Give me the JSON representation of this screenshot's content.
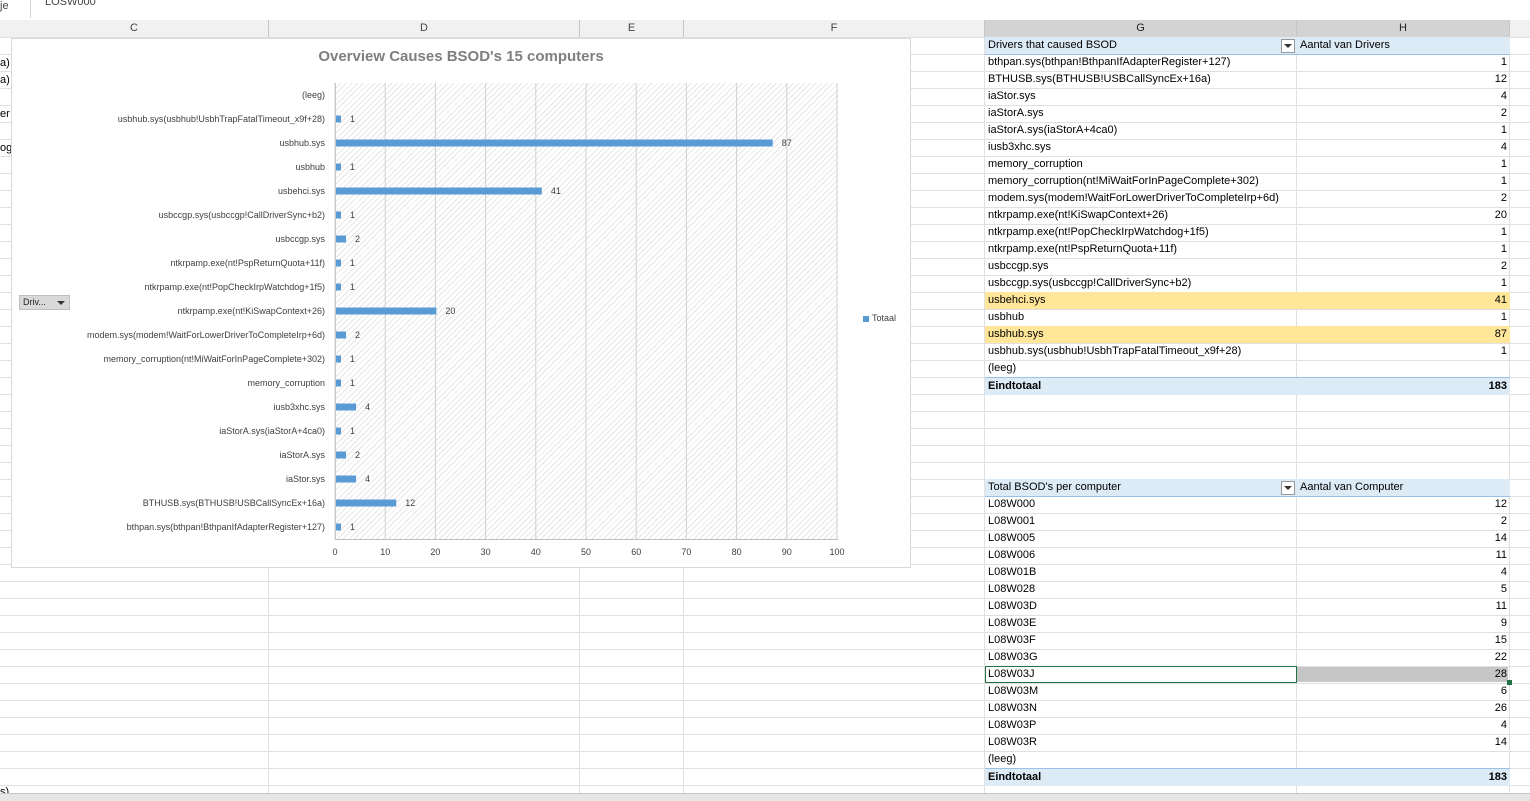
{
  "formula_bar": {
    "value": "LOSW000"
  },
  "columns": [
    "C",
    "D",
    "E",
    "F",
    "G",
    "H"
  ],
  "left_fragments": [
    "a)",
    "a)",
    "er",
    "og",
    "s)"
  ],
  "chart": {
    "title": "Overview Causes BSOD's 15 computers",
    "field_button": "Driv...",
    "legend": "Totaal"
  },
  "chart_data": {
    "type": "bar",
    "orientation": "horizontal",
    "title": "Overview Causes BSOD's 15 computers",
    "categories": [
      "(leeg)",
      "usbhub.sys(usbhub!UsbhTrapFatalTimeout_x9f+28)",
      "usbhub.sys",
      "usbhub",
      "usbehci.sys",
      "usbccgp.sys(usbccgp!CallDriverSync+b2)",
      "usbccgp.sys",
      "ntkrpamp.exe(nt!PspReturnQuota+11f)",
      "ntkrpamp.exe(nt!PopCheckIrpWatchdog+1f5)",
      "ntkrpamp.exe(nt!KiSwapContext+26)",
      "modem.sys(modem!WaitForLowerDriverToCompleteIrp+6d)",
      "memory_corruption(nt!MiWaitForInPageComplete+302)",
      "memory_corruption",
      "iusb3xhc.sys",
      "iaStorA.sys(iaStorA+4ca0)",
      "iaStorA.sys",
      "iaStor.sys",
      "BTHUSB.sys(BTHUSB!USBCallSyncEx+16a)",
      "bthpan.sys(bthpan!BthpanIfAdapterRegister+127)"
    ],
    "series": [
      {
        "name": "Totaal",
        "values": [
          null,
          1,
          87,
          1,
          41,
          1,
          2,
          1,
          1,
          20,
          2,
          1,
          1,
          4,
          1,
          2,
          4,
          12,
          1
        ]
      }
    ],
    "xlim": [
      0,
      100
    ],
    "xticks": [
      0,
      10,
      20,
      30,
      40,
      50,
      60,
      70,
      80,
      90,
      100
    ],
    "grid": true,
    "legend_position": "right",
    "color": "#5b9bd5"
  },
  "pivot1": {
    "header_row": "Drivers that caused BSOD",
    "header_value": "Aantal van Drivers",
    "rows": [
      {
        "label": "bthpan.sys(bthpan!BthpanIfAdapterRegister+127)",
        "value": "1"
      },
      {
        "label": "BTHUSB.sys(BTHUSB!USBCallSyncEx+16a)",
        "value": "12"
      },
      {
        "label": "iaStor.sys",
        "value": "4"
      },
      {
        "label": "iaStorA.sys",
        "value": "2"
      },
      {
        "label": "iaStorA.sys(iaStorA+4ca0)",
        "value": "1"
      },
      {
        "label": "iusb3xhc.sys",
        "value": "4"
      },
      {
        "label": "memory_corruption",
        "value": "1"
      },
      {
        "label": "memory_corruption(nt!MiWaitForInPageComplete+302)",
        "value": "1"
      },
      {
        "label": "modem.sys(modem!WaitForLowerDriverToCompleteIrp+6d)",
        "value": "2"
      },
      {
        "label": "ntkrpamp.exe(nt!KiSwapContext+26)",
        "value": "20"
      },
      {
        "label": "ntkrpamp.exe(nt!PopCheckIrpWatchdog+1f5)",
        "value": "1"
      },
      {
        "label": "ntkrpamp.exe(nt!PspReturnQuota+11f)",
        "value": "1"
      },
      {
        "label": "usbccgp.sys",
        "value": "2"
      },
      {
        "label": "usbccgp.sys(usbccgp!CallDriverSync+b2)",
        "value": "1"
      },
      {
        "label": "usbehci.sys",
        "value": "41"
      },
      {
        "label": "usbhub",
        "value": "1"
      },
      {
        "label": "usbhub.sys",
        "value": "87"
      },
      {
        "label": "usbhub.sys(usbhub!UsbhTrapFatalTimeout_x9f+28)",
        "value": "1"
      },
      {
        "label": "(leeg)",
        "value": ""
      }
    ],
    "total_label": "Eindtotaal",
    "total_value": "183"
  },
  "pivot2": {
    "header_row": "Total BSOD's per computer",
    "header_value": "Aantal van Computer",
    "rows": [
      {
        "label": "L08W000",
        "value": "12"
      },
      {
        "label": "L08W001",
        "value": "2"
      },
      {
        "label": "L08W005",
        "value": "14"
      },
      {
        "label": "L08W006",
        "value": "11"
      },
      {
        "label": "L08W01B",
        "value": "4"
      },
      {
        "label": "L08W028",
        "value": "5"
      },
      {
        "label": "L08W03D",
        "value": "11"
      },
      {
        "label": "L08W03E",
        "value": "9"
      },
      {
        "label": "L08W03F",
        "value": "15"
      },
      {
        "label": "L08W03G",
        "value": "22"
      },
      {
        "label": "L08W03J",
        "value": "28"
      },
      {
        "label": "L08W03M",
        "value": "6"
      },
      {
        "label": "L08W03N",
        "value": "26"
      },
      {
        "label": "L08W03P",
        "value": "4"
      },
      {
        "label": "L08W03R",
        "value": "14"
      },
      {
        "label": "(leeg)",
        "value": ""
      }
    ],
    "total_label": "Eindtotaal",
    "total_value": "183"
  }
}
